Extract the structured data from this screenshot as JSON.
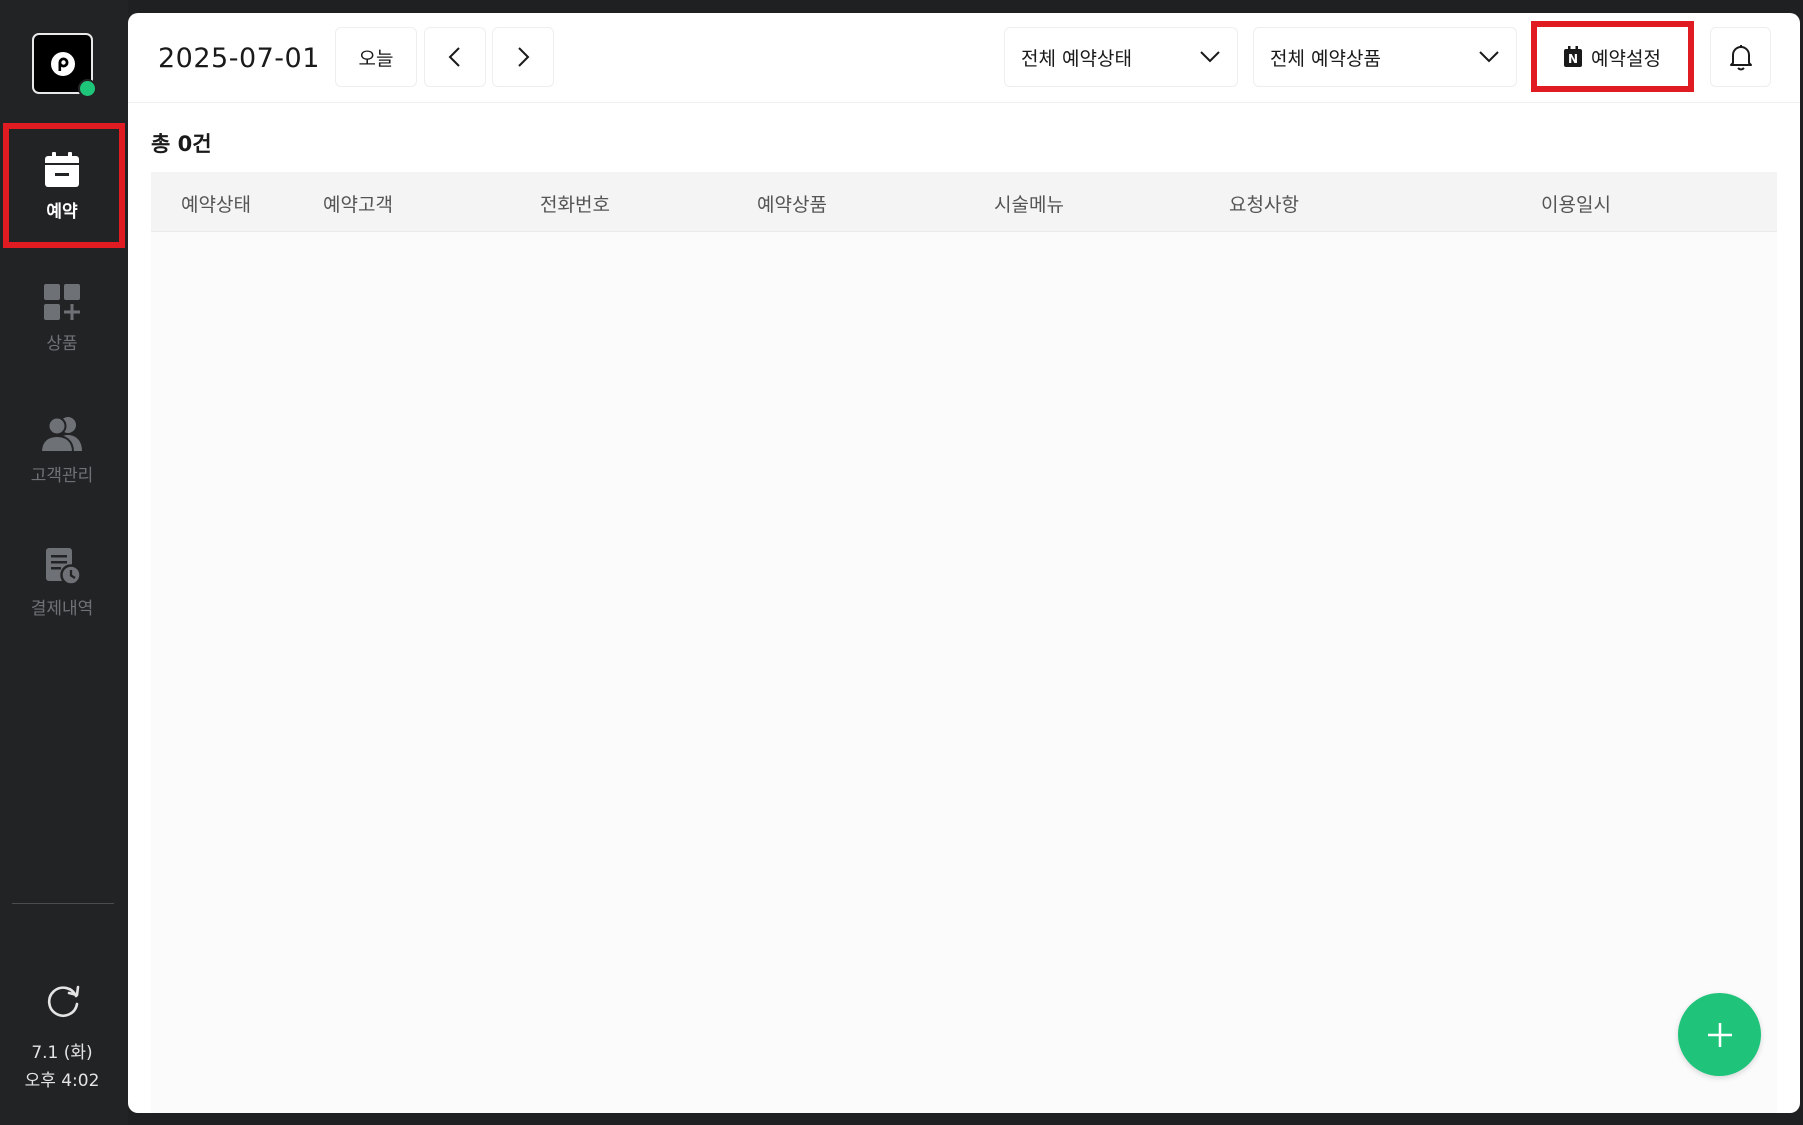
{
  "sidebar": {
    "logo_letter": "p",
    "items": [
      {
        "label": "예약",
        "icon": "calendar-icon",
        "active": true
      },
      {
        "label": "상품",
        "icon": "grid-plus-icon"
      },
      {
        "label": "고객관리",
        "icon": "people-icon"
      },
      {
        "label": "결제내역",
        "icon": "receipt-clock-icon"
      }
    ],
    "date_line": "7.1 (화)",
    "time_line": "오후 4:02"
  },
  "header": {
    "date": "2025-07-01",
    "today_label": "오늘",
    "status_filter": "전체 예약상태",
    "product_filter": "전체 예약상품",
    "settings_label": "예약설정",
    "settings_icon_letter": "N"
  },
  "summary": {
    "total": "총 0건"
  },
  "table": {
    "columns": [
      "예약상태",
      "예약고객",
      "전화번호",
      "예약상품",
      "시술메뉴",
      "요청사항",
      "이용일시"
    ],
    "rows": []
  },
  "colors": {
    "sidebar_bg": "#222325",
    "accent_green": "#1fc47a",
    "highlight_red": "#e11b22"
  }
}
